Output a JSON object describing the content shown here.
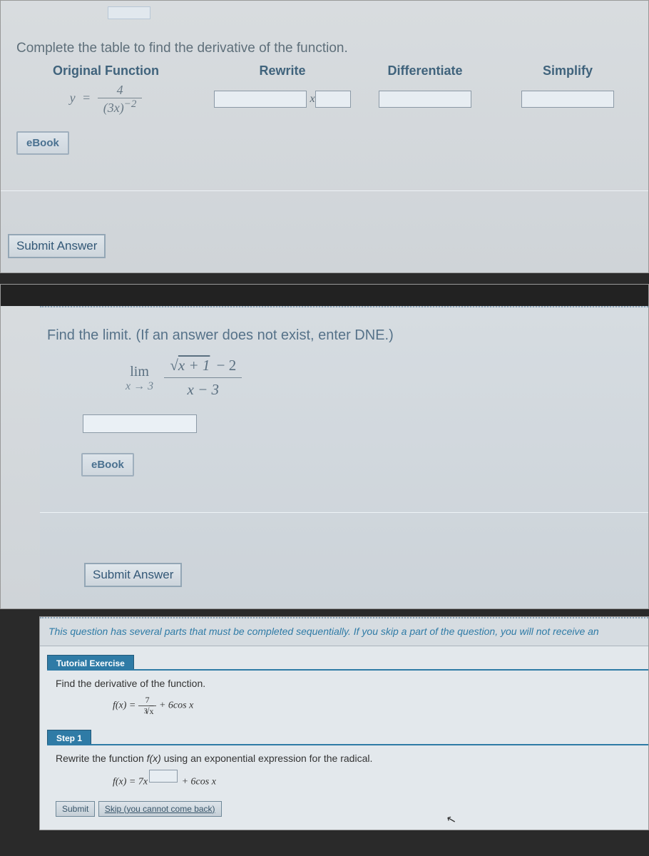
{
  "problem1": {
    "instruction": "Complete the table to find the derivative of the function.",
    "headers": {
      "original": "Original Function",
      "rewrite": "Rewrite",
      "differentiate": "Differentiate",
      "simplify": "Simplify"
    },
    "original": {
      "lhs": "y",
      "eq": "=",
      "num": "4",
      "den_base": "(3x)",
      "den_exp": "−2"
    },
    "xlabel": "x",
    "ebook": "eBook",
    "submit": "Submit Answer"
  },
  "problem2": {
    "instruction": "Find the limit. (If an answer does not exist, enter DNE.)",
    "lim": "lim",
    "approach": "x → 3",
    "numerator": "√(x + 1) − 2",
    "num_sqrt_inner": "x + 1",
    "num_tail": " − 2",
    "denominator": "x − 3",
    "ebook": "eBook",
    "submit": "Submit Answer"
  },
  "problem3": {
    "note": "This question has several parts that must be completed sequentially. If you skip a part of the question, you will not receive an",
    "tutorial_label": "Tutorial Exercise",
    "tutorial_text": "Find the derivative of the function.",
    "fx_label": "f(x) = ",
    "frac_num": "7",
    "frac_den_exp": "3",
    "frac_den_rad": "x",
    "tail": " + 6cos x",
    "step_label": "Step 1",
    "step_text_a": "Rewrite the function ",
    "step_fx": "f(x)",
    "step_text_b": " using an exponential expression for the radical.",
    "rewrite_lhs": "f(x) = 7x",
    "rewrite_tail": " + 6cos x",
    "submit": "Submit",
    "skip": "Skip (you cannot come back)"
  }
}
